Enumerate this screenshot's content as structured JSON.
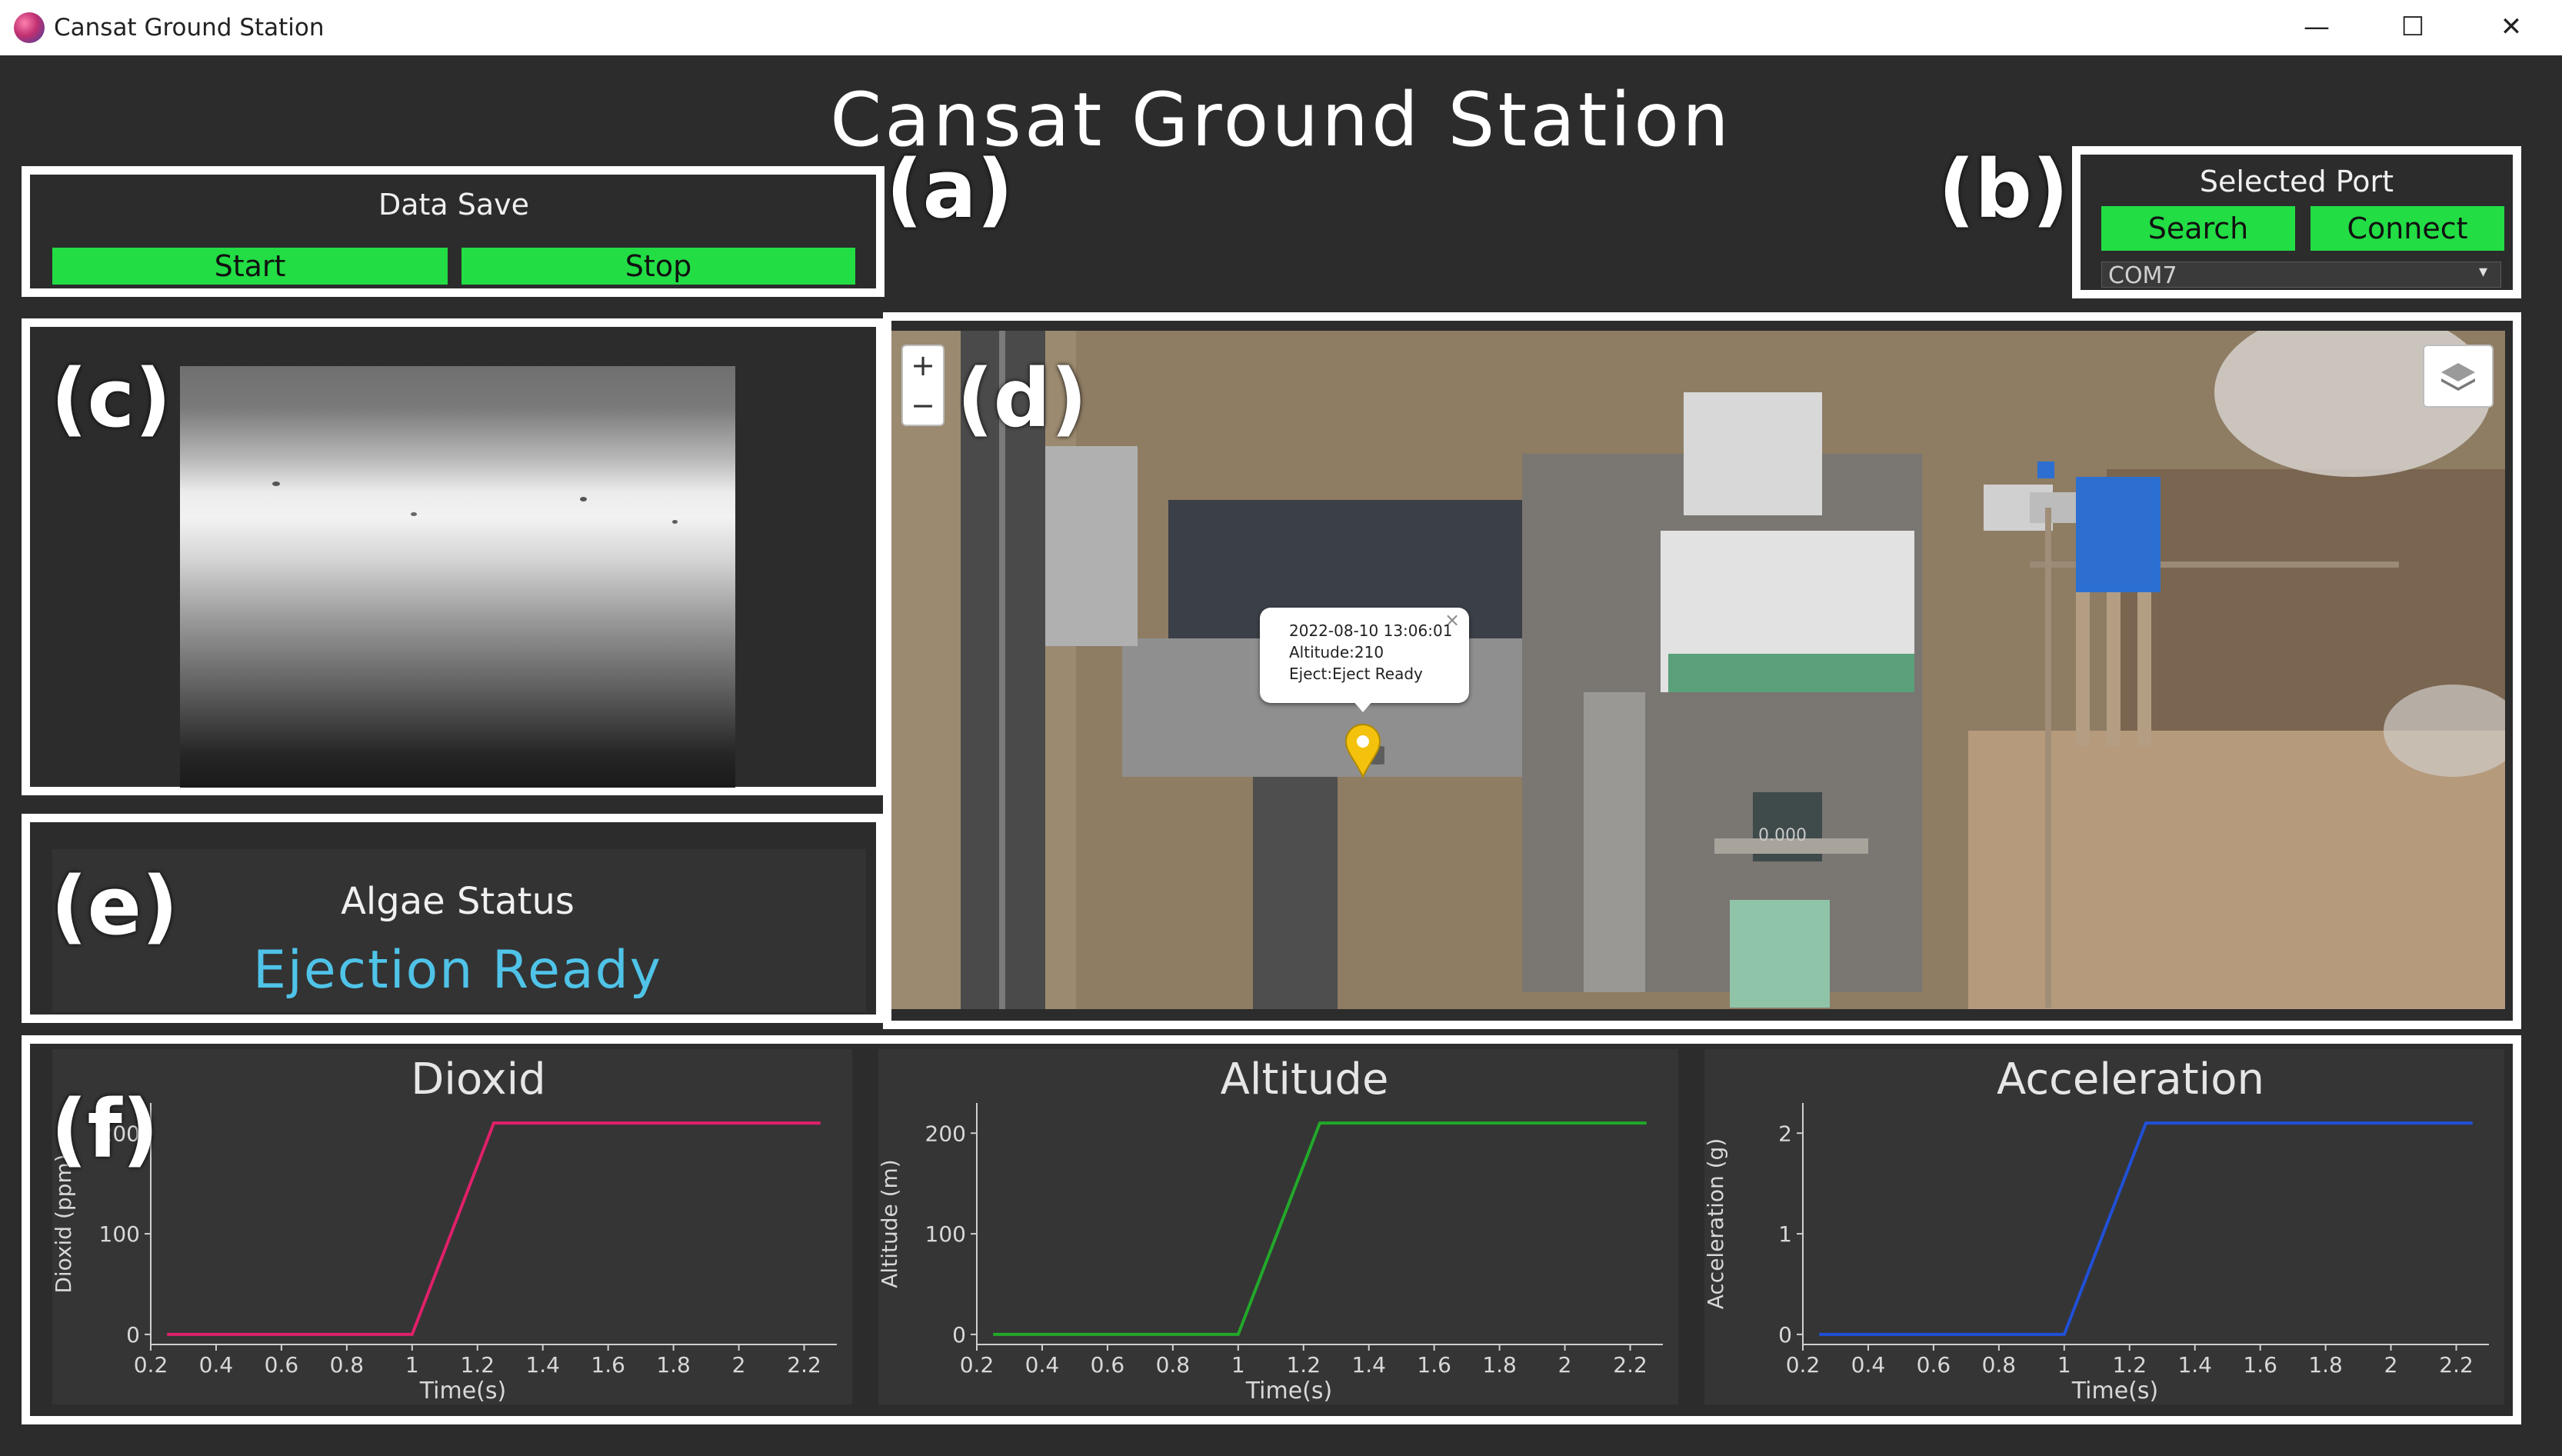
{
  "window": {
    "title": "Cansat Ground Station",
    "controls": {
      "minimize": "—",
      "maximize": "☐",
      "close": "✕"
    }
  },
  "app_title": "Cansat Ground Station",
  "panel_labels": {
    "a": "(a)",
    "b": "(b)",
    "c": "(c)",
    "d": "(d)",
    "e": "(e)",
    "f": "(f)"
  },
  "data_save": {
    "title": "Data Save",
    "start_label": "Start",
    "stop_label": "Stop"
  },
  "port": {
    "title": "Selected Port",
    "search_label": "Search",
    "connect_label": "Connect",
    "selected": "COM7"
  },
  "map": {
    "zoom_in": "+",
    "zoom_out": "−",
    "popup": {
      "close": "×",
      "time": "2022-08-10 13:06:01",
      "altitude": "Altitude:210",
      "eject": "Eject:Eject Ready"
    },
    "ground_text": "0.000"
  },
  "algae": {
    "title": "Algae Status",
    "status": "Ejection Ready",
    "status_color": "#4fc3e8"
  },
  "colors": {
    "button_green": "#22dd44",
    "background": "#2c2c2c",
    "panel_border": "#ffffff"
  },
  "chart_data": [
    {
      "type": "line",
      "title": "Dioxid",
      "xlabel": "Time(s)",
      "ylabel": "Dioxid (ppm)",
      "xlim": [
        0.2,
        2.3
      ],
      "ylim": [
        -10,
        230
      ],
      "xticks": [
        "0.2",
        "0.4",
        "0.6",
        "0.8",
        "1",
        "1.2",
        "1.4",
        "1.6",
        "1.8",
        "2",
        "2.2"
      ],
      "yticks": [
        "0",
        "100",
        "200"
      ],
      "color": "#e0206a",
      "x": [
        0.25,
        1.0,
        1.25,
        2.25
      ],
      "y": [
        0,
        0,
        210,
        210
      ]
    },
    {
      "type": "line",
      "title": "Altitude",
      "xlabel": "Time(s)",
      "ylabel": "Altitude (m)",
      "xlim": [
        0.2,
        2.3
      ],
      "ylim": [
        -10,
        230
      ],
      "xticks": [
        "0.2",
        "0.4",
        "0.6",
        "0.8",
        "1",
        "1.2",
        "1.4",
        "1.6",
        "1.8",
        "2",
        "2.2"
      ],
      "yticks": [
        "0",
        "100",
        "200"
      ],
      "color": "#22a82a",
      "x": [
        0.25,
        1.0,
        1.25,
        2.25
      ],
      "y": [
        0,
        0,
        210,
        210
      ]
    },
    {
      "type": "line",
      "title": "Acceleration",
      "xlabel": "Time(s)",
      "ylabel": "Acceleration (g)",
      "xlim": [
        0.2,
        2.3
      ],
      "ylim": [
        -0.1,
        2.3
      ],
      "xticks": [
        "0.2",
        "0.4",
        "0.6",
        "0.8",
        "1",
        "1.2",
        "1.4",
        "1.6",
        "1.8",
        "2",
        "2.2"
      ],
      "yticks": [
        "0",
        "1",
        "2"
      ],
      "color": "#2050d8",
      "x": [
        0.25,
        1.0,
        1.25,
        2.25
      ],
      "y": [
        0,
        0,
        2.1,
        2.1
      ]
    }
  ]
}
